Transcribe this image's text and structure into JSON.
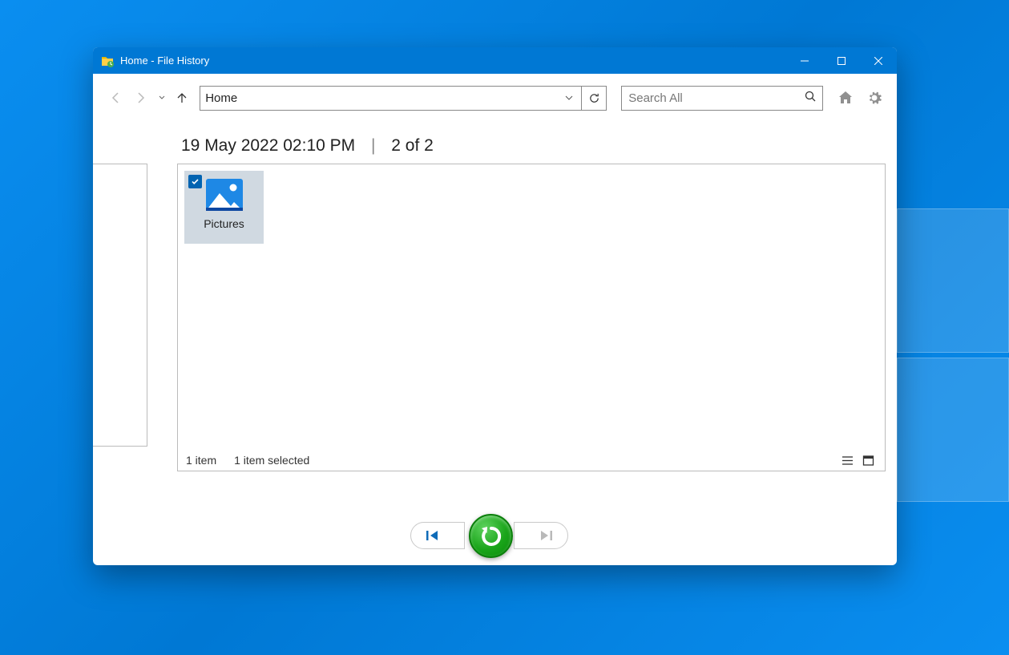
{
  "window": {
    "title": "Home - File History"
  },
  "nav": {
    "address": "Home",
    "search_placeholder": "Search All"
  },
  "info": {
    "timestamp": "19 May 2022 02:10 PM",
    "page_indicator": "2 of 2"
  },
  "item": {
    "name": "Pictures"
  },
  "status": {
    "count": "1 item",
    "selected": "1 item selected"
  }
}
